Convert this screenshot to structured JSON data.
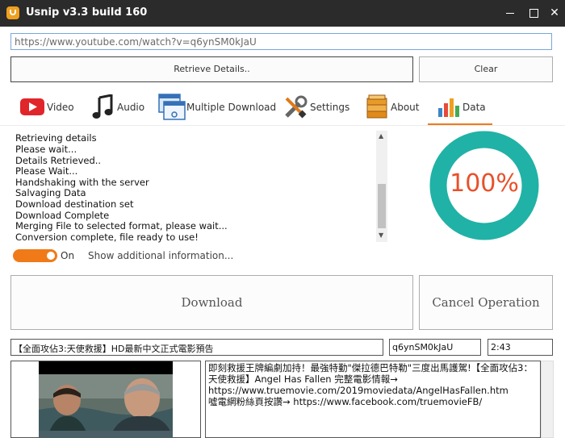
{
  "window": {
    "title": "Usnip v3.3 build 160"
  },
  "url_input": {
    "value": "https://www.youtube.com/watch?v=q6ynSM0kJaU"
  },
  "buttons": {
    "retrieve": "Retrieve Details..",
    "clear": "Clear",
    "download": "Download",
    "cancel": "Cancel Operation"
  },
  "tabs": [
    {
      "label": "Video",
      "icon": "youtube-play-icon"
    },
    {
      "label": "Audio",
      "icon": "music-note-icon"
    },
    {
      "label": "Multiple Download",
      "icon": "multiple-windows-icon"
    },
    {
      "label": "Settings",
      "icon": "wrench-screwdriver-icon"
    },
    {
      "label": "About",
      "icon": "books-icon"
    },
    {
      "label": "Data",
      "icon": "bar-chart-icon",
      "active": true
    }
  ],
  "log_lines": [
    "Retrieving details",
    "Please wait...",
    "Details Retrieved..",
    "Please Wait...",
    "Handshaking with the server",
    "Salvaging Data",
    "Download destination set",
    "Download Complete",
    "Merging File to selected format, please wait...",
    "Conversion complete, file ready to use!"
  ],
  "toggle": {
    "label": "On",
    "state": true
  },
  "more_info": "Show additional information...",
  "progress": {
    "percent": 100,
    "text": "100%"
  },
  "video": {
    "title": "【全面攻佔3:天使救援】HD最新中文正式電影預告",
    "id": "q6ynSM0kJaU",
    "duration": "2:43",
    "description_lines": [
      "即刻救援王牌編劇加持！最強特勤\"傑拉德巴特勒\"三度出馬護駕!【全面攻佔3：",
      "天使救援】Angel Has Fallen 完整電影情報→",
      "https://www.truemovie.com/2019moviedata/AngelHasFallen.htm",
      "噓電網粉絲頁按讚→ https://www.facebook.com/truemovieFB/"
    ]
  },
  "colors": {
    "accent": "#f07a18",
    "donut": "#20b2a6",
    "percent_text": "#e8502a",
    "titlebar": "#2b2b2b"
  }
}
